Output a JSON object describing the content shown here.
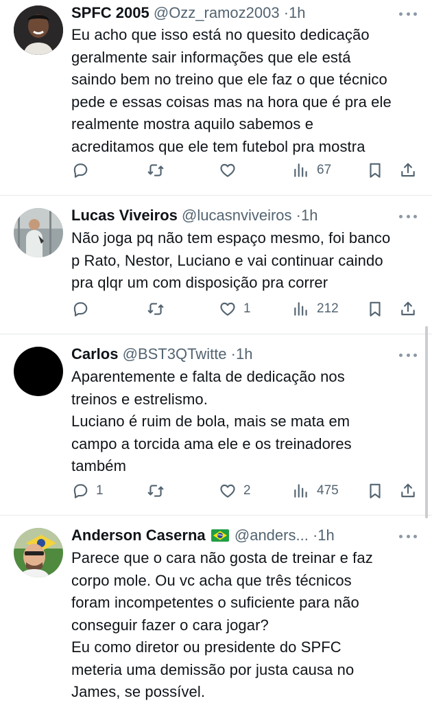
{
  "tweets": [
    {
      "name": "SPFC 2005",
      "handle": "@Ozz_ramoz2003",
      "dot": "·",
      "time": "1h",
      "text": "Eu acho que isso está no quesito dedicação\ngeralmente sair informações que ele está\nsaindo bem no treino que ele faz o que técnico\npede e essas coisas mas na hora que é pra ele\nrealmente mostra  aquilo sabemos e\nacreditamos que ele tem futebol pra mostra",
      "replies": "",
      "retweets": "",
      "likes": "",
      "views": "67"
    },
    {
      "name": "Lucas Viveiros",
      "handle": "@lucasnviveiros",
      "dot": "·",
      "time": "1h",
      "text": "Não joga pq não tem espaço mesmo, foi banco\np Rato, Nestor, Luciano e vai continuar caindo\npra qlqr um com disposição pra correr",
      "replies": "",
      "retweets": "",
      "likes": "1",
      "views": "212"
    },
    {
      "name": "Carlos",
      "handle": "@BST3QTwitte",
      "dot": "·",
      "time": "1h",
      "text": "Aparentemente e falta de dedicação nos\ntreinos e  estrelismo.\nLuciano é ruim de bola,  mais se mata em\ncampo  a torcida ama ele e os treinadores\ntambém",
      "replies": "1",
      "retweets": "",
      "likes": "2",
      "views": "475"
    },
    {
      "name": "Anderson Caserna",
      "handle": "@anders...",
      "dot": "·",
      "time": "1h",
      "text": "Parece que o cara não gosta de treinar e faz\ncorpo mole. Ou vc acha que três técnicos\nforam incompetentes o suficiente para não\nconseguir fazer o cara jogar?\nEu como diretor ou presidente do SPFC\nmeteria uma demissão por justa causa no\nJames, se possível.",
      "flag_icon": "brazil-flag-icon"
    }
  ],
  "icons": {
    "reply": "reply-icon",
    "retweet": "retweet-icon",
    "like": "heart-icon",
    "views": "views-icon",
    "bookmark": "bookmark-icon",
    "share": "share-icon",
    "more": "more-options-icon"
  },
  "colors": {
    "text": "#0f1419",
    "secondary": "#536471",
    "separator": "#e6e9eb"
  }
}
